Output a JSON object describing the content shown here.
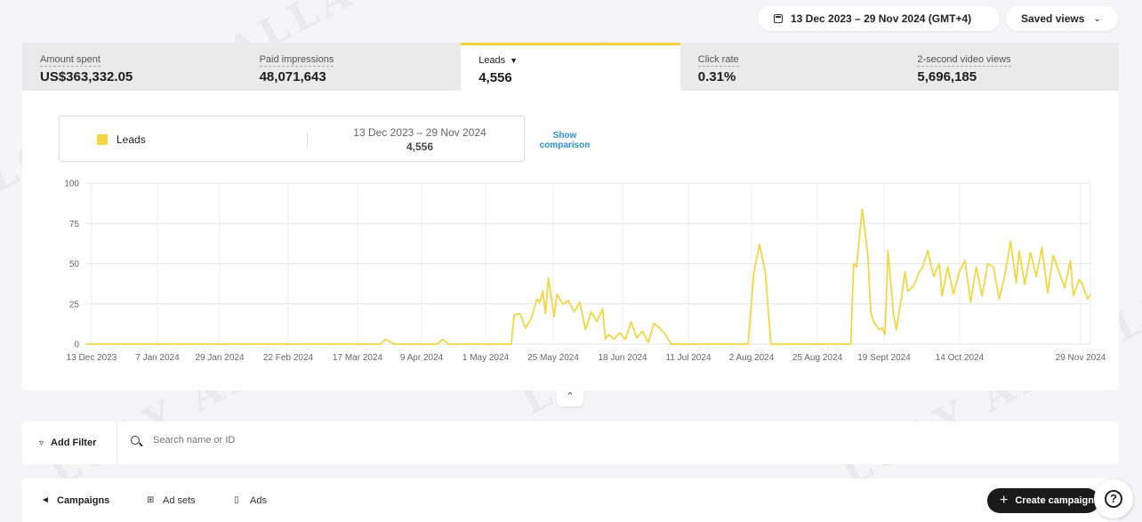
{
  "header": {
    "date_range": "13 Dec 2023 – 29 Nov 2024 (GMT+4)",
    "saved_views": "Saved views"
  },
  "metrics": [
    {
      "label": "Amount spent",
      "value": "US$363,332.05"
    },
    {
      "label": "Paid impressions",
      "value": "48,071,643"
    },
    {
      "label": "Leads",
      "value": "4,556"
    },
    {
      "label": "Click rate",
      "value": "0.31%"
    },
    {
      "label": "2-second video views",
      "value": "5,696,185"
    }
  ],
  "legend": {
    "series_name": "Leads",
    "range": "13 Dec 2023 – 29 Nov 2024",
    "total": "4,556",
    "show_comparison": "Show comparison"
  },
  "chart_data": {
    "type": "line",
    "series": [
      {
        "name": "Leads",
        "color": "#f2d742"
      }
    ],
    "x_tick_labels": [
      "13 Dec 2023",
      "7 Jan 2024",
      "29 Jan 2024",
      "22 Feb 2024",
      "17 Mar 2024",
      "9 Apr 2024",
      "1 May 2024",
      "25 May 2024",
      "18 Jun 2024",
      "11 Jul 2024",
      "2 Aug 2024",
      "25 Aug 2024",
      "19 Sept 2024",
      "14 Oct 2024",
      "29 Nov 2024"
    ],
    "y_ticks": [
      0,
      25,
      50,
      75,
      100
    ],
    "ylim": [
      0,
      100
    ],
    "grid": true,
    "points": [
      {
        "x": "2023-12-13",
        "y": 0
      },
      {
        "x": "2024-03-25",
        "y": 0
      },
      {
        "x": "2024-03-27",
        "y": 3
      },
      {
        "x": "2024-03-30",
        "y": 0
      },
      {
        "x": "2024-04-14",
        "y": 0
      },
      {
        "x": "2024-04-16",
        "y": 3
      },
      {
        "x": "2024-04-18",
        "y": 0
      },
      {
        "x": "2024-05-10",
        "y": 0
      },
      {
        "x": "2024-05-11",
        "y": 18
      },
      {
        "x": "2024-05-13",
        "y": 19
      },
      {
        "x": "2024-05-15",
        "y": 10
      },
      {
        "x": "2024-05-17",
        "y": 16
      },
      {
        "x": "2024-05-19",
        "y": 28
      },
      {
        "x": "2024-05-20",
        "y": 26
      },
      {
        "x": "2024-05-21",
        "y": 33
      },
      {
        "x": "2024-05-22",
        "y": 19
      },
      {
        "x": "2024-05-23",
        "y": 41
      },
      {
        "x": "2024-05-25",
        "y": 17
      },
      {
        "x": "2024-05-26",
        "y": 31
      },
      {
        "x": "2024-05-28",
        "y": 25
      },
      {
        "x": "2024-05-30",
        "y": 27
      },
      {
        "x": "2024-06-01",
        "y": 20
      },
      {
        "x": "2024-06-03",
        "y": 26
      },
      {
        "x": "2024-06-05",
        "y": 9
      },
      {
        "x": "2024-06-07",
        "y": 20
      },
      {
        "x": "2024-06-09",
        "y": 14
      },
      {
        "x": "2024-06-11",
        "y": 22
      },
      {
        "x": "2024-06-12",
        "y": 3
      },
      {
        "x": "2024-06-13",
        "y": 6
      },
      {
        "x": "2024-06-15",
        "y": 3
      },
      {
        "x": "2024-06-17",
        "y": 7
      },
      {
        "x": "2024-06-19",
        "y": 3
      },
      {
        "x": "2024-06-21",
        "y": 14
      },
      {
        "x": "2024-06-23",
        "y": 4
      },
      {
        "x": "2024-06-25",
        "y": 8
      },
      {
        "x": "2024-06-27",
        "y": 1
      },
      {
        "x": "2024-06-29",
        "y": 13
      },
      {
        "x": "2024-07-01",
        "y": 10
      },
      {
        "x": "2024-07-03",
        "y": 6
      },
      {
        "x": "2024-07-05",
        "y": 0
      },
      {
        "x": "2024-08-01",
        "y": 0
      },
      {
        "x": "2024-08-03",
        "y": 44
      },
      {
        "x": "2024-08-05",
        "y": 62
      },
      {
        "x": "2024-08-07",
        "y": 45
      },
      {
        "x": "2024-08-09",
        "y": 0
      },
      {
        "x": "2024-09-06",
        "y": 0
      },
      {
        "x": "2024-09-07",
        "y": 50
      },
      {
        "x": "2024-09-08",
        "y": 48
      },
      {
        "x": "2024-09-10",
        "y": 84
      },
      {
        "x": "2024-09-12",
        "y": 55
      },
      {
        "x": "2024-09-13",
        "y": 20
      },
      {
        "x": "2024-09-14",
        "y": 14
      },
      {
        "x": "2024-09-16",
        "y": 9
      },
      {
        "x": "2024-09-17",
        "y": 10
      },
      {
        "x": "2024-09-18",
        "y": 6
      },
      {
        "x": "2024-09-19",
        "y": 58
      },
      {
        "x": "2024-09-21",
        "y": 18
      },
      {
        "x": "2024-09-22",
        "y": 9
      },
      {
        "x": "2024-09-24",
        "y": 32
      },
      {
        "x": "2024-09-25",
        "y": 45
      },
      {
        "x": "2024-09-26",
        "y": 33
      },
      {
        "x": "2024-09-28",
        "y": 36
      },
      {
        "x": "2024-09-30",
        "y": 45
      },
      {
        "x": "2024-10-01",
        "y": 47
      },
      {
        "x": "2024-10-03",
        "y": 58
      },
      {
        "x": "2024-10-05",
        "y": 42
      },
      {
        "x": "2024-10-07",
        "y": 50
      },
      {
        "x": "2024-10-08",
        "y": 30
      },
      {
        "x": "2024-10-10",
        "y": 48
      },
      {
        "x": "2024-10-12",
        "y": 31
      },
      {
        "x": "2024-10-14",
        "y": 45
      },
      {
        "x": "2024-10-16",
        "y": 52
      },
      {
        "x": "2024-10-18",
        "y": 26
      },
      {
        "x": "2024-10-20",
        "y": 48
      },
      {
        "x": "2024-10-22",
        "y": 30
      },
      {
        "x": "2024-10-24",
        "y": 50
      },
      {
        "x": "2024-10-26",
        "y": 48
      },
      {
        "x": "2024-10-28",
        "y": 28
      },
      {
        "x": "2024-10-30",
        "y": 43
      },
      {
        "x": "2024-11-01",
        "y": 64
      },
      {
        "x": "2024-11-03",
        "y": 38
      },
      {
        "x": "2024-11-04",
        "y": 58
      },
      {
        "x": "2024-11-06",
        "y": 37
      },
      {
        "x": "2024-11-08",
        "y": 57
      },
      {
        "x": "2024-11-10",
        "y": 42
      },
      {
        "x": "2024-11-12",
        "y": 60
      },
      {
        "x": "2024-11-14",
        "y": 32
      },
      {
        "x": "2024-11-16",
        "y": 55
      },
      {
        "x": "2024-11-18",
        "y": 45
      },
      {
        "x": "2024-11-20",
        "y": 35
      },
      {
        "x": "2024-11-22",
        "y": 52
      },
      {
        "x": "2024-11-23",
        "y": 30
      },
      {
        "x": "2024-11-25",
        "y": 40
      },
      {
        "x": "2024-11-26",
        "y": 38
      },
      {
        "x": "2024-11-28",
        "y": 28
      },
      {
        "x": "2024-11-29",
        "y": 31
      }
    ]
  },
  "toolbar": {
    "add_filter": "Add Filter",
    "search_placeholder": "Search name or ID"
  },
  "tabs": [
    {
      "label": "Campaigns",
      "icon": "megaphone-icon"
    },
    {
      "label": "Ad sets",
      "icon": "grid-icon"
    },
    {
      "label": "Ads",
      "icon": "phone-icon"
    }
  ],
  "create_label": "Create campaign",
  "watermark_text": "LOAY ABDALLAH"
}
